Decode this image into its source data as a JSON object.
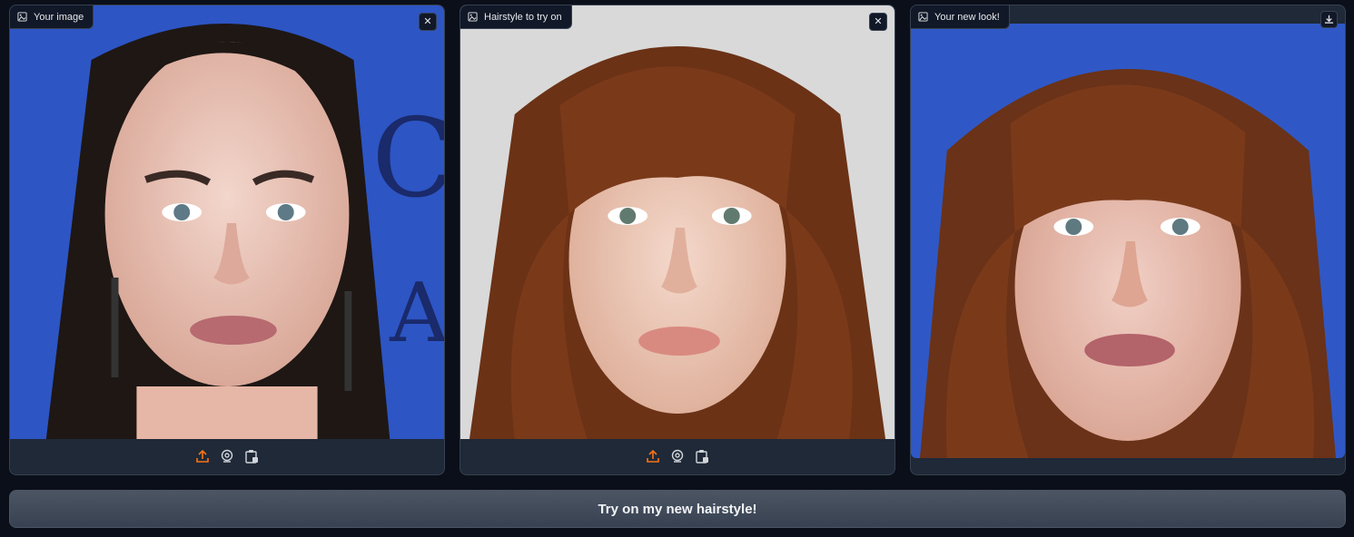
{
  "panels": [
    {
      "label": "Your image",
      "button_icon": "close-icon"
    },
    {
      "label": "Hairstyle to try on",
      "button_icon": "close-icon"
    },
    {
      "label": "Your new look!",
      "button_icon": "download-icon"
    }
  ],
  "toolbar_icons": [
    "upload-icon",
    "webcam-icon",
    "clipboard-icon"
  ],
  "main_button": {
    "label": "Try on my new hairstyle!"
  },
  "colors": {
    "background": "#0b0f19",
    "panel": "#1f2937",
    "accent_upload": "#f97316",
    "button": "#4b5563"
  }
}
